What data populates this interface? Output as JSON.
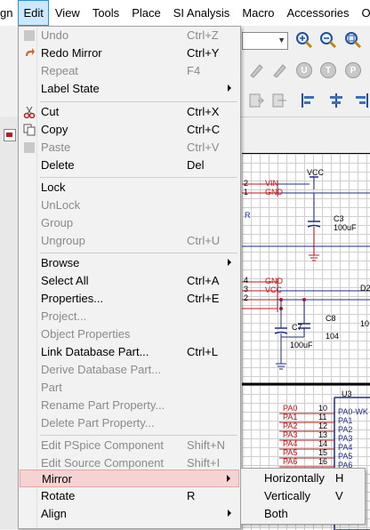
{
  "menubar": {
    "items": [
      "gn",
      "Edit",
      "View",
      "Tools",
      "Place",
      "SI Analysis",
      "Macro",
      "Accessories",
      "Op"
    ]
  },
  "edit_menu": {
    "items": [
      {
        "label": "Undo",
        "shortcut": "Ctrl+Z",
        "enabled": false,
        "icon": "undo-icon"
      },
      {
        "label": "Redo Mirror",
        "shortcut": "Ctrl+Y",
        "enabled": true,
        "icon": "redo-icon"
      },
      {
        "label": "Repeat",
        "shortcut": "F4",
        "enabled": false
      },
      {
        "label": "Label State",
        "shortcut": "",
        "enabled": true,
        "submenu": true
      },
      {
        "label": "Cut",
        "shortcut": "Ctrl+X",
        "enabled": true,
        "icon": "scissors-icon"
      },
      {
        "label": "Copy",
        "shortcut": "Ctrl+C",
        "enabled": true,
        "icon": "copy-icon"
      },
      {
        "label": "Paste",
        "shortcut": "Ctrl+V",
        "enabled": false,
        "icon": "paste-icon"
      },
      {
        "label": "Delete",
        "shortcut": "Del",
        "enabled": true
      },
      {
        "label": "Lock",
        "shortcut": "",
        "enabled": true
      },
      {
        "label": "UnLock",
        "shortcut": "",
        "enabled": false
      },
      {
        "label": "Group",
        "shortcut": "",
        "enabled": false
      },
      {
        "label": "Ungroup",
        "shortcut": "Ctrl+U",
        "enabled": false
      },
      {
        "label": "Browse",
        "shortcut": "",
        "enabled": true,
        "submenu": true
      },
      {
        "label": "Select All",
        "shortcut": "Ctrl+A",
        "enabled": true
      },
      {
        "label": "Properties...",
        "shortcut": "Ctrl+E",
        "enabled": true
      },
      {
        "label": "Project...",
        "shortcut": "",
        "enabled": false
      },
      {
        "label": "Object Properties",
        "shortcut": "",
        "enabled": false
      },
      {
        "label": "Link Database Part...",
        "shortcut": "Ctrl+L",
        "enabled": true
      },
      {
        "label": "Derive Database Part...",
        "shortcut": "",
        "enabled": false
      },
      {
        "label": "Part",
        "shortcut": "",
        "enabled": false
      },
      {
        "label": "Rename Part Property...",
        "shortcut": "",
        "enabled": false
      },
      {
        "label": "Delete Part Property...",
        "shortcut": "",
        "enabled": false
      },
      {
        "label": "Edit PSpice Component",
        "shortcut": "Shift+N",
        "enabled": false
      },
      {
        "label": "Edit Source Component",
        "shortcut": "Shift+I",
        "enabled": false
      },
      {
        "label": "Mirror",
        "shortcut": "",
        "enabled": true,
        "submenu": true,
        "highlighted": true
      },
      {
        "label": "Rotate",
        "shortcut": "R",
        "enabled": true
      },
      {
        "label": "Align",
        "shortcut": "",
        "enabled": true,
        "submenu": true
      }
    ]
  },
  "mirror_submenu": {
    "items": [
      {
        "label": "Horizontally",
        "shortcut": "H"
      },
      {
        "label": "Vertically",
        "shortcut": "V"
      },
      {
        "label": "Both",
        "shortcut": ""
      }
    ]
  },
  "schematic": {
    "labels": {
      "vcc_top": "VCC",
      "vin": "VIN",
      "gnd1": "GND",
      "pin2": "2",
      "pin1": "1",
      "r_frag": "R",
      "c3": "C3",
      "c3_val": "100uF",
      "pin4": "4",
      "pin3": "3",
      "pin2b": "2",
      "gnd2": "GND",
      "vcc2": "VCC",
      "d2": "D2",
      "c8": "C8",
      "c7": "C7",
      "c8_val": "104",
      "c7_val": "100uF",
      "ten": "10",
      "u3": "U3",
      "pa_nets": [
        "PA0",
        "PA1",
        "PA2",
        "PA3",
        "PA4",
        "PA5",
        "PA6"
      ],
      "pin_numbers": [
        "10",
        "11",
        "12",
        "13",
        "14",
        "15",
        "16"
      ],
      "pin_names": [
        "PA0-WK",
        "PA1",
        "PA2",
        "PA3",
        "PA4",
        "PA5",
        "PA6"
      ]
    }
  },
  "colors": {
    "menu_active_bg": "#cce8ff",
    "menu_highlight_bg": "#f5d3d3",
    "wire_blue": "#1f2d8a",
    "net_red": "#c4161c",
    "pin_red": "#b01818"
  }
}
